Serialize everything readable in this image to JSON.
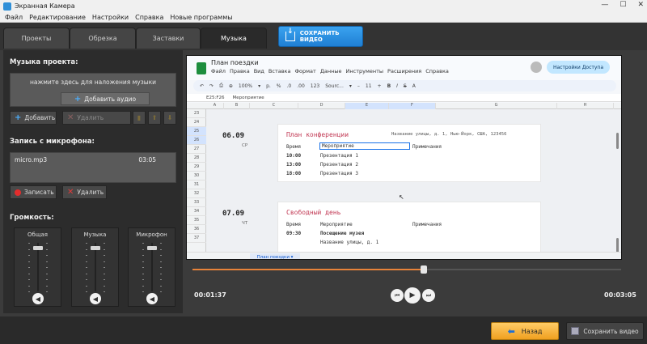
{
  "window": {
    "title": "Экранная Камера",
    "controls": [
      "—",
      "☐",
      "✕"
    ]
  },
  "menu": [
    "Файл",
    "Редактирование",
    "Настройки",
    "Справка",
    "Новые программы"
  ],
  "tabs": [
    {
      "label": "Проекты"
    },
    {
      "label": "Обрезка"
    },
    {
      "label": "Заставки"
    },
    {
      "label": "Музыка"
    }
  ],
  "save_video_top": "СОХРАНИТЬ ВИДЕО",
  "music_section": {
    "title": "Музыка проекта:",
    "hint": "нажмите здесь для наложения музыки",
    "add_audio": "Добавить аудио",
    "add": "Добавить",
    "delete": "Удалить"
  },
  "mic_section": {
    "title": "Запись с микрофона:",
    "file": "micro.mp3",
    "duration": "03:05",
    "record": "Записать",
    "delete": "Удалить"
  },
  "volume_section": {
    "title": "Громкость:",
    "sliders": [
      {
        "label": "Общая",
        "level": 0.9
      },
      {
        "label": "Музыка",
        "level": 0.9
      },
      {
        "label": "Микрофон",
        "level": 0.9
      }
    ]
  },
  "preview": {
    "doc_title": "План поездки",
    "menu": [
      "Файл",
      "Правка",
      "Вид",
      "Вставка",
      "Формат",
      "Данные",
      "Инструменты",
      "Расширения",
      "Справка"
    ],
    "share": "Настройки Доступа",
    "toolbar": [
      "↶",
      "↷",
      "⎙",
      "⊕",
      "100%",
      "▾",
      "р.",
      "%",
      ".0",
      ".00",
      "123",
      "Sourc...",
      "▾",
      "–",
      "11",
      "+",
      "B",
      "I",
      "S",
      "A"
    ],
    "cell_ref": "E25:F26",
    "formula": "Мероприятие",
    "columns": [
      "A",
      "B",
      "C",
      "D",
      "E",
      "F",
      "G",
      "H"
    ],
    "rows": [
      "23",
      "24",
      "25",
      "26",
      "27",
      "28",
      "29",
      "30",
      "31",
      "32",
      "33",
      "34",
      "35",
      "36",
      "37"
    ],
    "day1": {
      "date": "06.09",
      "dow": "СР",
      "title": "План конференции",
      "address": "Название улицы, д. 1, Нью-Йорк, США, 123456",
      "headers": [
        "Время",
        "Мероприятие",
        "Примечания"
      ],
      "rows": [
        [
          "10:00",
          "Презентация 1"
        ],
        [
          "13:00",
          "Презентация 2"
        ],
        [
          "18:00",
          "Презентация 3"
        ]
      ]
    },
    "day2": {
      "date": "07.09",
      "dow": "ЧТ",
      "title": "Свободный день",
      "headers": [
        "Время",
        "Мероприятие",
        "Примечания"
      ],
      "rows": [
        [
          "09:30",
          "Посещение музея"
        ],
        [
          "",
          "Название улицы, д. 1"
        ]
      ]
    },
    "sheet_tab": "План поездки ▾"
  },
  "player": {
    "current": "00:01:37",
    "total": "00:03:05",
    "progress": 0.54
  },
  "bottom": {
    "back": "Назад",
    "save": "Сохранить видео"
  },
  "colors": {
    "accent": "#1f7fd3",
    "orange": "#f0a020",
    "record": "#e32d2d"
  }
}
